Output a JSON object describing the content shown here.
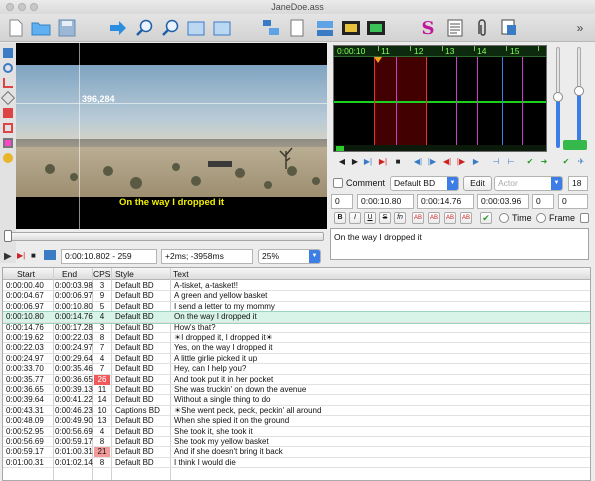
{
  "window": {
    "title": "JaneDoe.ass"
  },
  "video": {
    "coords": "396,284",
    "subtitle": "On the way I dropped it",
    "time_field": "0:00:10.802 - 259",
    "offset_field": "+2ms; -3958ms",
    "zoom": "25%"
  },
  "audio": {
    "ruler_labels": [
      "0:00:10",
      "11",
      "12",
      "13",
      "14",
      "15"
    ],
    "accent": "#3d7ee6",
    "waveform_color": "#1bd21b"
  },
  "edit": {
    "comment_label": "Comment",
    "style": "Default BD",
    "edit_button": "Edit",
    "actor_placeholder": "Actor",
    "margin_value": "18",
    "layer": "0",
    "start": "0:00:10.80",
    "end": "0:00:14.76",
    "duration": "0:00:03.96",
    "margin_l": "0",
    "margin_r": "0",
    "format_buttons": [
      "B",
      "I",
      "U",
      "S",
      "fn",
      "AB",
      "AB",
      "AB",
      "AB"
    ],
    "time_radio": "Time",
    "frame_radio": "Frame",
    "text": "On the way I dropped it"
  },
  "grid": {
    "columns": [
      "Start",
      "End",
      "CPS",
      "Style",
      "Text"
    ],
    "rows": [
      {
        "start": "0:00:00.40",
        "end": "0:00:03.98",
        "cps": "3",
        "style": "Default BD",
        "text": "A-tisket, a-tasket!!"
      },
      {
        "start": "0:00:04.67",
        "end": "0:00:06.97",
        "cps": "9",
        "style": "Default BD",
        "text": "A green and yellow basket"
      },
      {
        "start": "0:00:06.97",
        "end": "0:00:10.80",
        "cps": "5",
        "style": "Default BD",
        "text": "I send a letter to my mommy"
      },
      {
        "start": "0:00:10.80",
        "end": "0:00:14.76",
        "cps": "4",
        "style": "Default BD",
        "text": "On the way I dropped it"
      },
      {
        "start": "0:00:14.76",
        "end": "0:00:17.28",
        "cps": "3",
        "style": "Default BD",
        "text": "How's that?"
      },
      {
        "start": "0:00:19.62",
        "end": "0:00:22.03",
        "cps": "8",
        "style": "Default BD",
        "text": "☀I dropped it, I dropped it☀"
      },
      {
        "start": "0:00:22.03",
        "end": "0:00:24.97",
        "cps": "7",
        "style": "Default BD",
        "text": "Yes, on the way I dropped it"
      },
      {
        "start": "0:00:24.97",
        "end": "0:00:29.64",
        "cps": "4",
        "style": "Default BD",
        "text": "A little girlie picked it up"
      },
      {
        "start": "0:00:33.70",
        "end": "0:00:35.46",
        "cps": "7",
        "style": "Default BD",
        "text": "Hey, can I help you?"
      },
      {
        "start": "0:00:35.77",
        "end": "0:00:36.65",
        "cps": "26",
        "style": "Default BD",
        "text": "And took put it in her pocket"
      },
      {
        "start": "0:00:36.65",
        "end": "0:00:39.13",
        "cps": "11",
        "style": "Default BD",
        "text": "She was truckin' on down the avenue"
      },
      {
        "start": "0:00:39.64",
        "end": "0:00:41.22",
        "cps": "14",
        "style": "Default BD",
        "text": "Without a single thing to do"
      },
      {
        "start": "0:00:43.31",
        "end": "0:00:46.23",
        "cps": "10",
        "style": "Captions BD",
        "text": "☀She went peck, peck, peckin' all around"
      },
      {
        "start": "0:00:48.09",
        "end": "0:00:49.90",
        "cps": "13",
        "style": "Default BD",
        "text": "When she spied it on the ground"
      },
      {
        "start": "0:00:52.95",
        "end": "0:00:56.69",
        "cps": "4",
        "style": "Default BD",
        "text": "She took it, she took it"
      },
      {
        "start": "0:00:56.69",
        "end": "0:00:59.17",
        "cps": "8",
        "style": "Default BD",
        "text": "She took my yellow basket"
      },
      {
        "start": "0:00:59.17",
        "end": "0:01:00.31",
        "cps": "21",
        "style": "Default BD",
        "text": "And if she doesn't bring it back"
      },
      {
        "start": "0:01:00.31",
        "end": "0:01:02.14",
        "cps": "8",
        "style": "Default BD",
        "text": "I think I would die"
      }
    ]
  }
}
